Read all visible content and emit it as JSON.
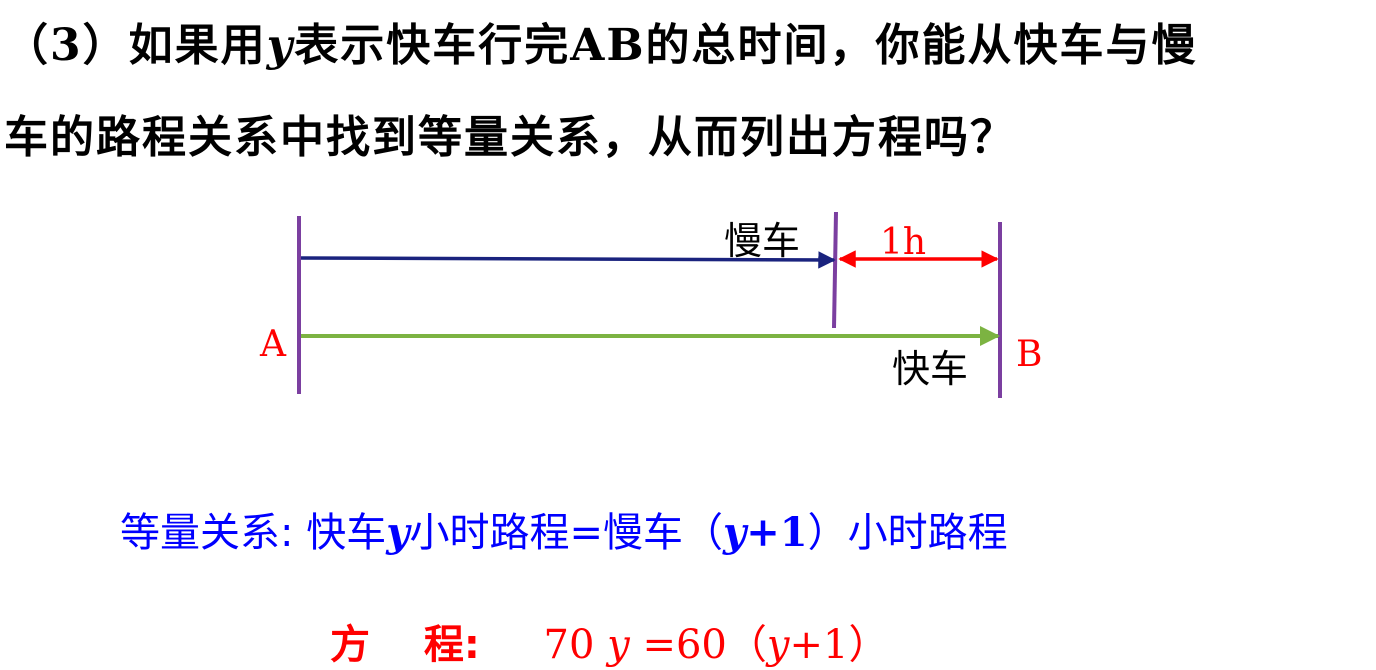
{
  "question": {
    "line1_prefix": "（3）如果用",
    "var": "y",
    "line1_suffix": "表示快车行完AB的总时间，你能从快车与慢",
    "line2": "车的路程关系中找到等量关系，从而列出方程吗？"
  },
  "diagram": {
    "label_A": "A",
    "label_B": "B",
    "label_slow": "慢车",
    "label_fast": "快车",
    "label_gap": "1h",
    "colors": {
      "slow_line": "#1a237e",
      "fast_line": "#7cb342",
      "gap_line": "#ff0000",
      "markers": "#7b3fa0",
      "endpoint_labels": "#ff0000",
      "gap_label": "#ff0000"
    }
  },
  "relation": {
    "prefix": "等量关系: 快车",
    "var1": "y",
    "mid": "小时路程=慢车（",
    "var2": "y",
    "plus": "+1",
    "suffix": "）小时路程",
    "color": "#0000ff"
  },
  "equation": {
    "label": "方　 程:",
    "lhs_num": "70",
    "lhs_var": "y",
    "eq": "=60（",
    "rhs_var": "y",
    "rhs_tail": "+1）",
    "color": "#ff0000"
  }
}
